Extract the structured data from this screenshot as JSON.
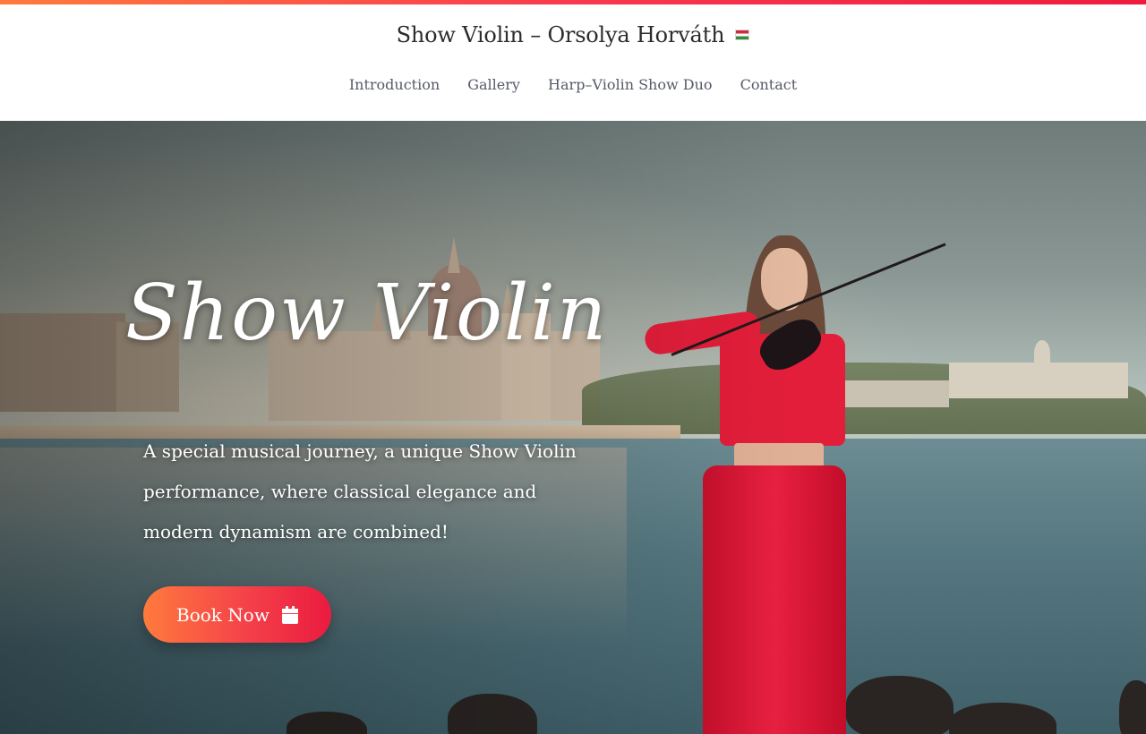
{
  "header": {
    "title": "Show Violin – Orsolya Horváth",
    "language_flag": "hungarian-flag-icon"
  },
  "nav": {
    "items": [
      {
        "label": "Introduction"
      },
      {
        "label": "Gallery"
      },
      {
        "label": "Harp–Violin Show Duo"
      },
      {
        "label": "Contact"
      }
    ]
  },
  "hero": {
    "script_title": "Show Violin",
    "tagline": "A special musical journey, a unique Show Violin performance, where classical elegance and modern dynamism are combined!",
    "cta_label": "Book Now",
    "cta_icon": "calendar-icon"
  },
  "colors": {
    "accent_start": "#ff7a3d",
    "accent_end": "#ea1b3f",
    "nav_text": "#555a66",
    "title_text": "#2c2c2c"
  }
}
